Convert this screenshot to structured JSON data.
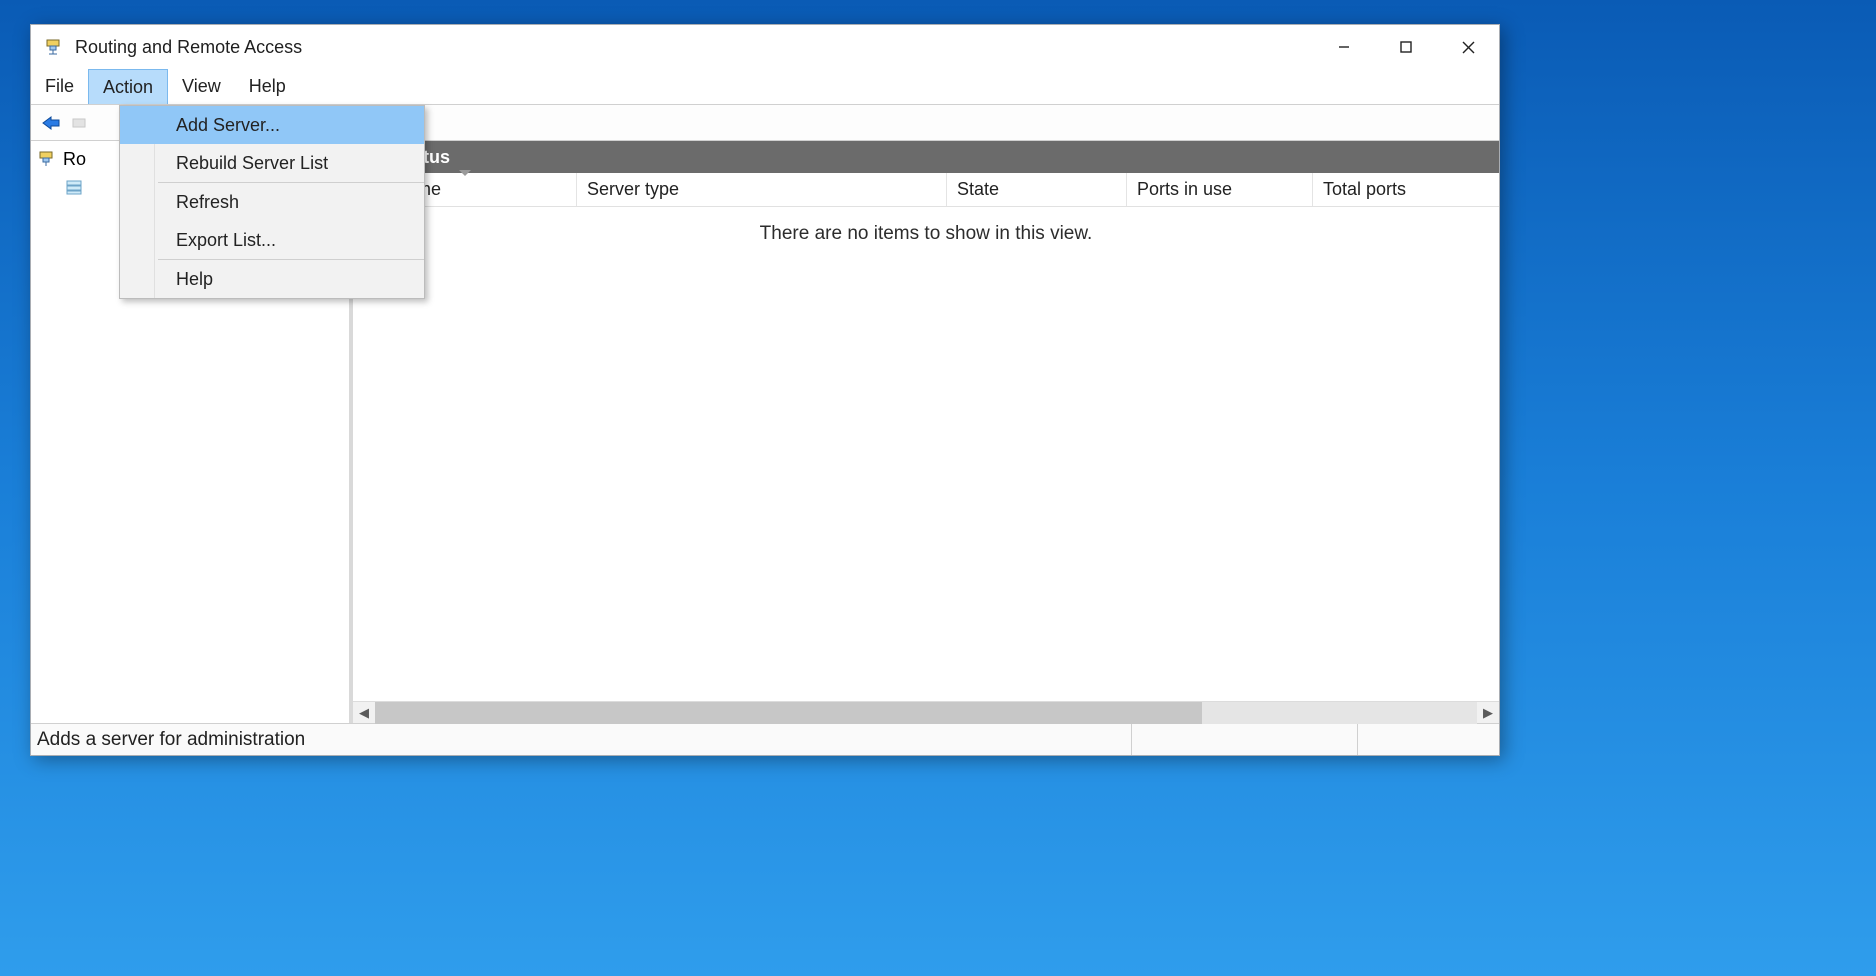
{
  "window": {
    "title": "Routing and Remote Access"
  },
  "menubar": {
    "file": "File",
    "action": "Action",
    "view": "View",
    "help": "Help"
  },
  "action_menu": {
    "add_server": "Add Server...",
    "rebuild": "Rebuild Server List",
    "refresh": "Refresh",
    "export": "Export List...",
    "help": "Help"
  },
  "tree": {
    "root_visible_fragment": "Ro"
  },
  "content": {
    "header_visible_fragment": "ver Status",
    "columns": {
      "server_name_visible_fragment": "ver Name",
      "server_type": "Server type",
      "state": "State",
      "ports_in_use": "Ports in use",
      "total_ports": "Total ports"
    },
    "empty_message": "There are no items to show in this view."
  },
  "statusbar": {
    "text": "Adds a server for administration"
  }
}
